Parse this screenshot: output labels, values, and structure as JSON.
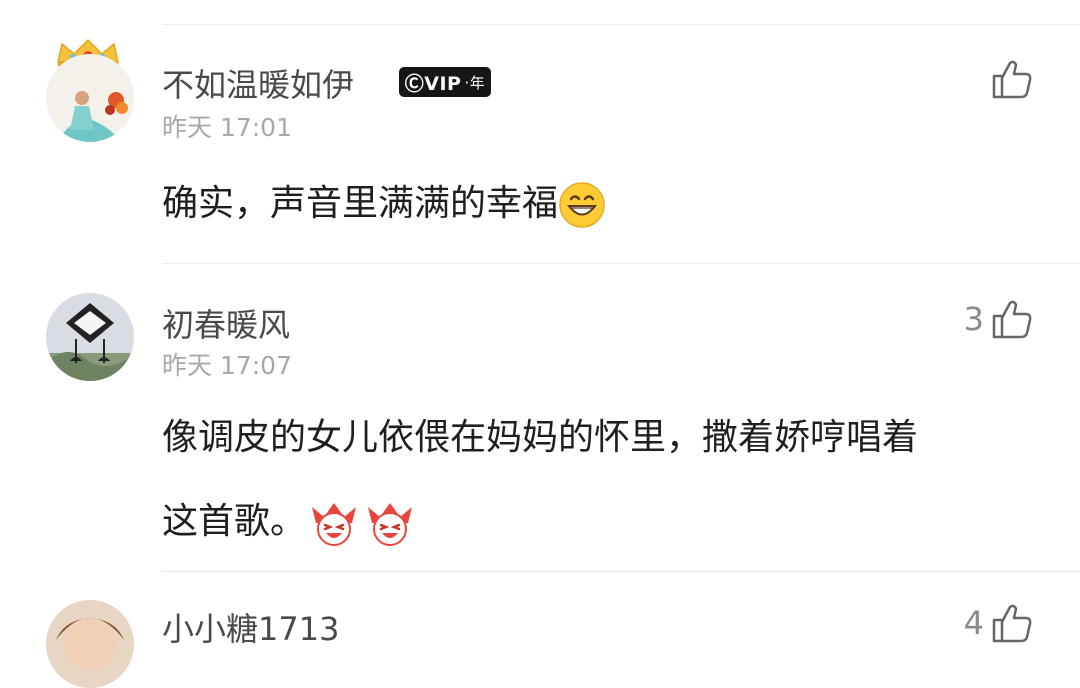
{
  "comments": [
    {
      "username": "不如温暖如伊",
      "vip_badge": "ⒸVIP",
      "vip_suffix": "·年",
      "time": "昨天 17:01",
      "content": "确实，声音里满满的幸福",
      "content_emojis": [
        "grinning-face-emoji"
      ],
      "likes": ""
    },
    {
      "username": "初春暖风",
      "time": "昨天 17:07",
      "content_line1": "像调皮的女儿依偎在妈妈的怀里，撒着娇哼唱着",
      "content_line2": "这首歌。",
      "content_emojis": [
        "jester-face-emoji",
        "jester-face-emoji"
      ],
      "likes": "3"
    },
    {
      "username": "小小糖1713",
      "likes": "4"
    }
  ],
  "icons": {
    "like": "thumbs-up-icon",
    "crown": "crown-icon"
  },
  "colors": {
    "username": "#4a4a4a",
    "time": "#a8a8a8",
    "content": "#1f1f1f",
    "divider": "#ececec",
    "crown": "#f3c13a"
  }
}
